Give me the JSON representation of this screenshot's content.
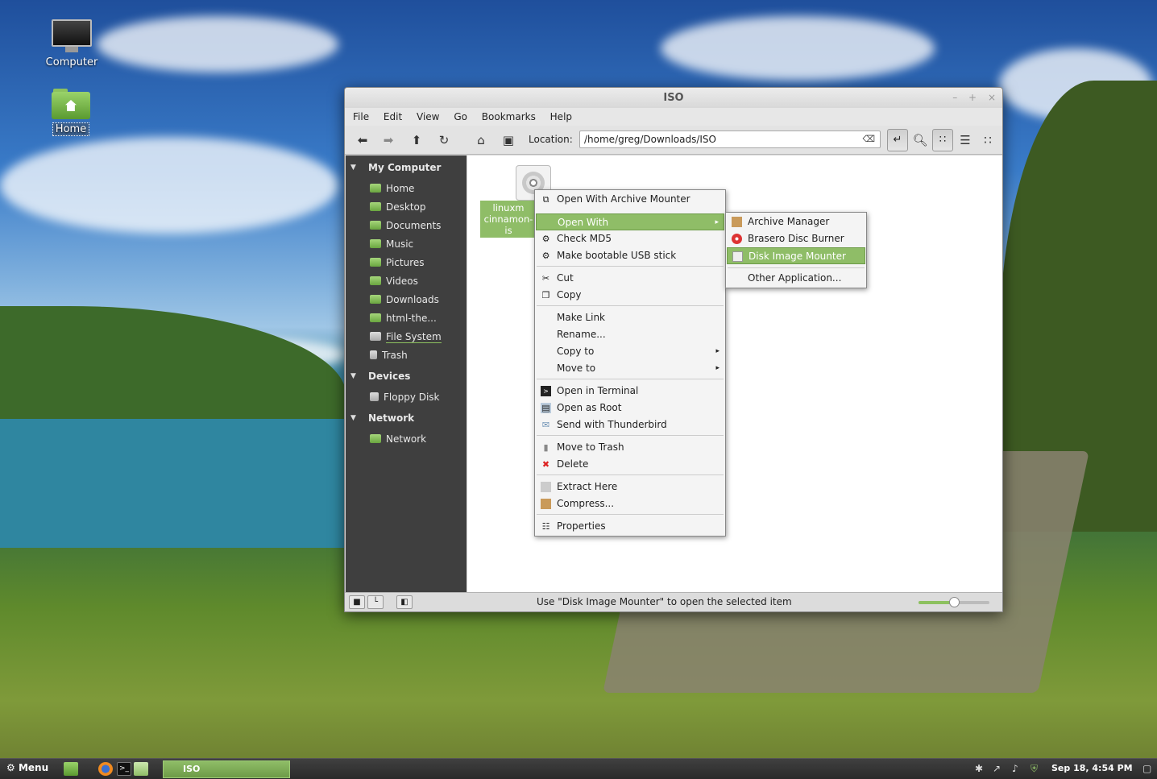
{
  "desktop": {
    "icons": [
      {
        "label": "Computer"
      },
      {
        "label": "Home"
      }
    ]
  },
  "window": {
    "title": "ISO",
    "controls": {
      "minimize": "–",
      "maximize": "+",
      "close": "×"
    },
    "menubar": [
      "File",
      "Edit",
      "View",
      "Go",
      "Bookmarks",
      "Help"
    ],
    "toolbar": {
      "location_label": "Location:",
      "location_value": "/home/greg/Downloads/ISO"
    },
    "sidebar": {
      "sections": [
        {
          "title": "My Computer",
          "items": [
            "Home",
            "Desktop",
            "Documents",
            "Music",
            "Pictures",
            "Videos",
            "Downloads",
            "html-the...",
            "File System",
            "Trash"
          ]
        },
        {
          "title": "Devices",
          "items": [
            "Floppy Disk"
          ]
        },
        {
          "title": "Network",
          "items": [
            "Network"
          ]
        }
      ],
      "selected": "File System"
    },
    "file": {
      "label_line1": "linuxm",
      "label_line2": "cinnamon-",
      "label_line3": "is"
    },
    "statusbar": {
      "text": "Use \"Disk Image Mounter\" to open the selected item",
      "zoom_fraction": 0.5
    }
  },
  "context_menu": {
    "items": [
      {
        "label": "Open With Archive Mounter",
        "icon": "open-with-icon"
      },
      {
        "label": "Open With",
        "icon": "",
        "submenu": true,
        "highlighted": true
      },
      {
        "label": "Check MD5",
        "icon": "gear-icon"
      },
      {
        "label": "Make bootable USB stick",
        "icon": "gear-icon"
      },
      {
        "label": "Cut",
        "icon": "scissors-icon"
      },
      {
        "label": "Copy",
        "icon": "copy-icon"
      },
      {
        "label": "Make Link",
        "icon": ""
      },
      {
        "label": "Rename...",
        "icon": ""
      },
      {
        "label": "Copy to",
        "icon": "",
        "submenu": true
      },
      {
        "label": "Move to",
        "icon": "",
        "submenu": true
      },
      {
        "label": "Open in Terminal",
        "icon": "terminal-icon"
      },
      {
        "label": "Open as Root",
        "icon": "root-icon"
      },
      {
        "label": "Send with Thunderbird",
        "icon": "mail-icon"
      },
      {
        "label": "Move to Trash",
        "icon": "trash-icon"
      },
      {
        "label": "Delete",
        "icon": "delete-icon"
      },
      {
        "label": "Extract Here",
        "icon": "extract-icon"
      },
      {
        "label": "Compress...",
        "icon": "archive-icon"
      },
      {
        "label": "Properties",
        "icon": "properties-icon"
      }
    ]
  },
  "submenu": {
    "items": [
      {
        "label": "Archive Manager"
      },
      {
        "label": "Brasero Disc Burner"
      },
      {
        "label": "Disk Image Mounter",
        "highlighted": true
      },
      {
        "label": "Other Application..."
      }
    ]
  },
  "taskbar": {
    "menu_label": "Menu",
    "window_label": "ISO",
    "clock": "Sep 18,  4:54 PM"
  },
  "colors": {
    "accent": "#8fbd67",
    "sidebar_bg": "#3f3f3f"
  }
}
